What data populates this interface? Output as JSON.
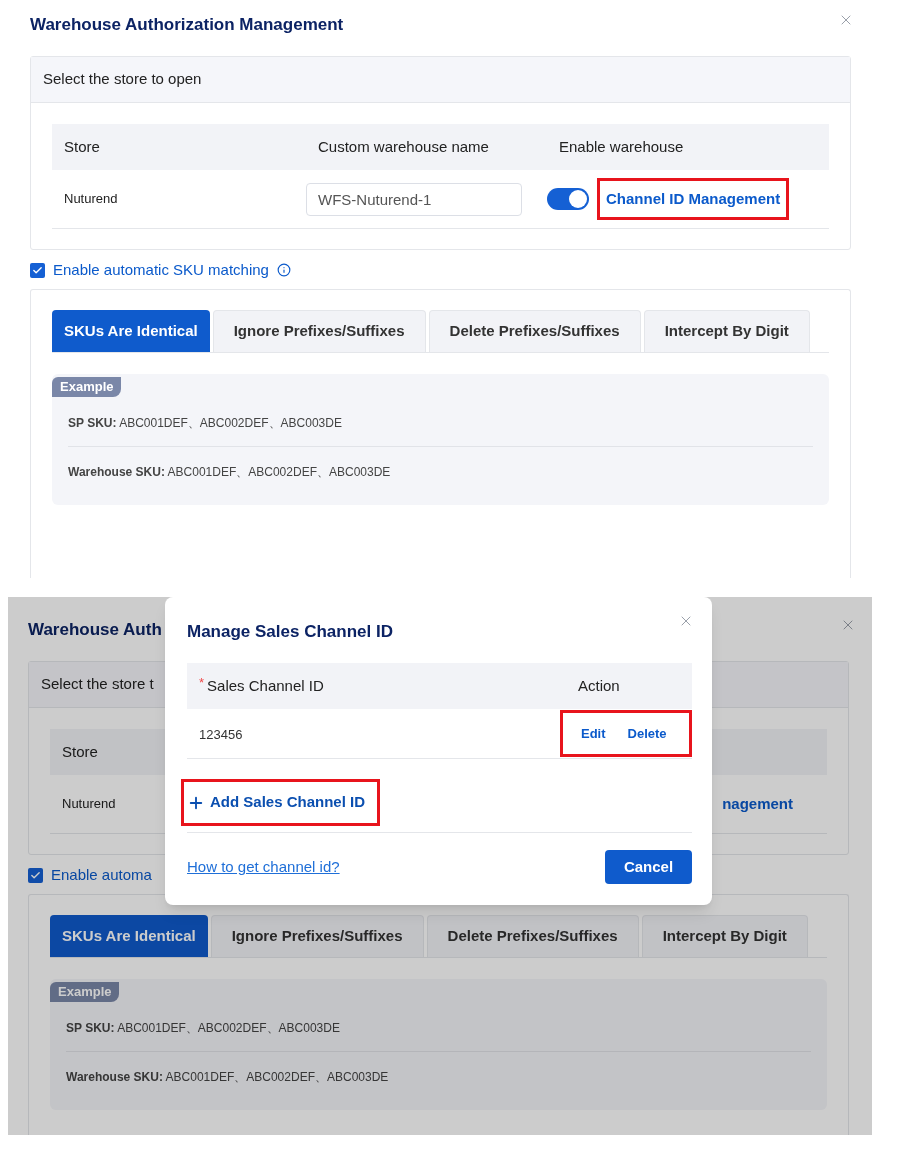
{
  "main_dialog": {
    "title": "Warehouse Authorization Management",
    "store_section": {
      "title": "Select the store to open",
      "columns": [
        "Store",
        "Custom warehouse name",
        "Enable warehouse"
      ],
      "rows": [
        {
          "store": "Nuturend",
          "warehouse_name": "WFS-Nuturend-1",
          "enabled": true,
          "link": "Channel ID Management"
        }
      ]
    },
    "auto_sku": {
      "label": "Enable automatic SKU matching",
      "checked": true
    },
    "tabs": [
      {
        "label": "SKUs Are Identical",
        "selected": true
      },
      {
        "label": "Ignore Prefixes/Suffixes",
        "selected": false
      },
      {
        "label": "Delete Prefixes/Suffixes",
        "selected": false
      },
      {
        "label": "Intercept By Digit",
        "selected": false
      }
    ],
    "example": {
      "tag": "Example",
      "lines": [
        "**SP SKU:** ABC001DEF、ABC002DEF、ABC003DE",
        "**Warehouse SKU:** ABC001DEF、ABC002DEF、ABC003DE"
      ]
    }
  },
  "dimmed_dialog": {
    "title": "Warehouse Auth",
    "store_section": {
      "title": "Select the store t",
      "columns": [
        "Store"
      ],
      "rows": [
        {
          "store": "Nuturend",
          "link": "nagement"
        }
      ]
    },
    "auto_sku": {
      "label": "Enable automa",
      "checked": true
    },
    "tabs": [
      {
        "label": "SKUs Are Identical",
        "selected": true
      },
      {
        "label": "Ignore Prefixes/Suffixes",
        "selected": false
      },
      {
        "label": "Delete Prefixes/Suffixes",
        "selected": false
      },
      {
        "label": "Intercept By Digit",
        "selected": false
      }
    ],
    "example": {
      "tag": "Example",
      "lines": [
        "**SP SKU:** ABC001DEF、ABC002DEF、ABC003DE",
        "**Warehouse SKU:** ABC001DEF、ABC002DEF、ABC003DE"
      ]
    }
  },
  "modal": {
    "title": "Manage Sales Channel ID",
    "columns": [
      {
        "label": "Sales Channel ID",
        "required_mark": "*"
      },
      {
        "label": "Action"
      }
    ],
    "rows": [
      {
        "id": "123456",
        "actions": [
          "Edit",
          "Delete"
        ]
      }
    ],
    "add_label": "Add Sales Channel ID",
    "help_link": "How to get channel id?",
    "cancel": "Cancel"
  }
}
